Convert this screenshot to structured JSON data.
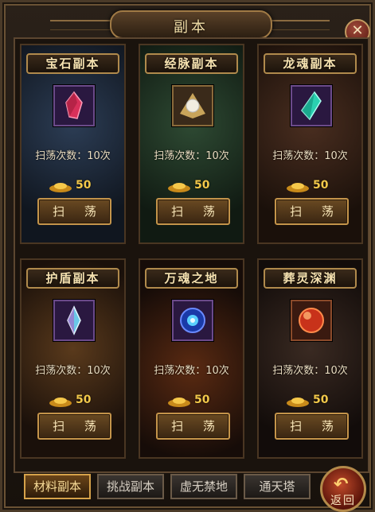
{
  "window": {
    "title": "副本",
    "close_icon": "close-icon"
  },
  "dungeons": [
    {
      "name": "宝石副本",
      "icon": "red-gem-icon",
      "sweep_count": "扫荡次数：10次",
      "cost": "50",
      "sweep_label": "扫 荡"
    },
    {
      "name": "经脉副本",
      "icon": "pearl-icon",
      "sweep_count": "扫荡次数：10次",
      "cost": "50",
      "sweep_label": "扫 荡"
    },
    {
      "name": "龙魂副本",
      "icon": "cyan-crystal-icon",
      "sweep_count": "扫荡次数：10次",
      "cost": "50",
      "sweep_label": "扫 荡"
    },
    {
      "name": "护盾副本",
      "icon": "shield-crystal-icon",
      "sweep_count": "扫荡次数：10次",
      "cost": "50",
      "sweep_label": "扫 荡"
    },
    {
      "name": "万魂之地",
      "icon": "blue-soul-orb-icon",
      "sweep_count": "扫荡次数：10次",
      "cost": "50",
      "sweep_label": "扫 荡"
    },
    {
      "name": "葬灵深渊",
      "icon": "red-orb-icon",
      "sweep_count": "扫荡次数：10次",
      "cost": "50",
      "sweep_label": "扫 荡"
    }
  ],
  "tabs": [
    {
      "label": "材料副本",
      "active": true
    },
    {
      "label": "挑战副本",
      "active": false
    },
    {
      "label": "虚无禁地",
      "active": false
    },
    {
      "label": "通天塔",
      "active": false
    }
  ],
  "back_button": {
    "label": "返回"
  },
  "colors": {
    "gold": "#f2c84a",
    "frame": "#b08a4c",
    "text": "#e9dcc0"
  }
}
